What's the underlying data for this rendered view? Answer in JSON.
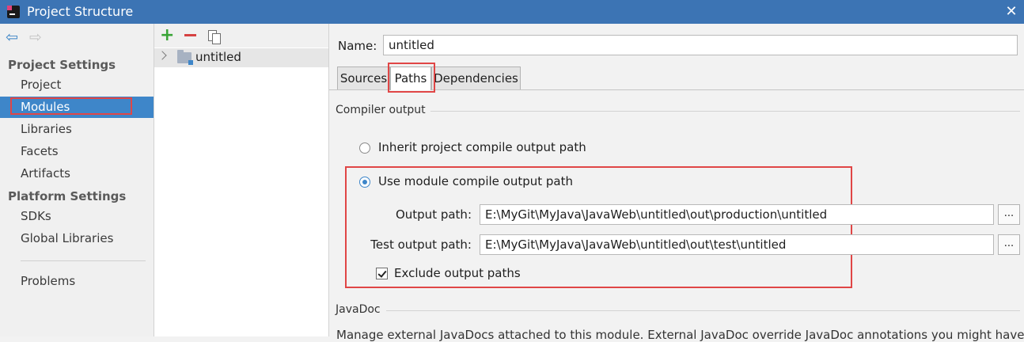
{
  "window": {
    "title": "Project Structure",
    "close_glyph": "✕"
  },
  "nav": {
    "back_glyph": "⇦",
    "forward_glyph": "⇨",
    "project_settings_heading": "Project Settings",
    "platform_settings_heading": "Platform Settings",
    "items": {
      "project": "Project",
      "modules": "Modules",
      "libraries": "Libraries",
      "facets": "Facets",
      "artifacts": "Artifacts",
      "sdks": "SDKs",
      "global_libraries": "Global Libraries",
      "problems": "Problems"
    },
    "selected": "Modules"
  },
  "module_tree": {
    "add_glyph": "+",
    "items": [
      {
        "label": "untitled"
      }
    ]
  },
  "module": {
    "name_label": "Name:",
    "name_value": "untitled",
    "tabs": {
      "sources": "Sources",
      "paths": "Paths",
      "dependencies": "Dependencies"
    },
    "active_tab": "Paths",
    "compiler_output": {
      "section_title": "Compiler output",
      "inherit_label": "Inherit project compile output path",
      "use_module_label": "Use module compile output path",
      "selected": "use_module",
      "output_path_label": "Output path:",
      "output_path": "E:\\MyGit\\MyJava\\JavaWeb\\untitled\\out\\production\\untitled",
      "test_output_path_label": "Test output path:",
      "test_output_path": "E:\\MyGit\\MyJava\\JavaWeb\\untitled\\out\\test\\untitled",
      "browse_label": "...",
      "exclude_label": "Exclude output paths",
      "exclude_checked": true
    },
    "javadoc": {
      "section_title": "JavaDoc",
      "description": "Manage external JavaDocs attached to this module. External JavaDoc override JavaDoc annotations you might have in your"
    }
  },
  "colors": {
    "titlebar": "#3c74b4",
    "selection": "#3e86c9",
    "highlight": "#e04646"
  }
}
